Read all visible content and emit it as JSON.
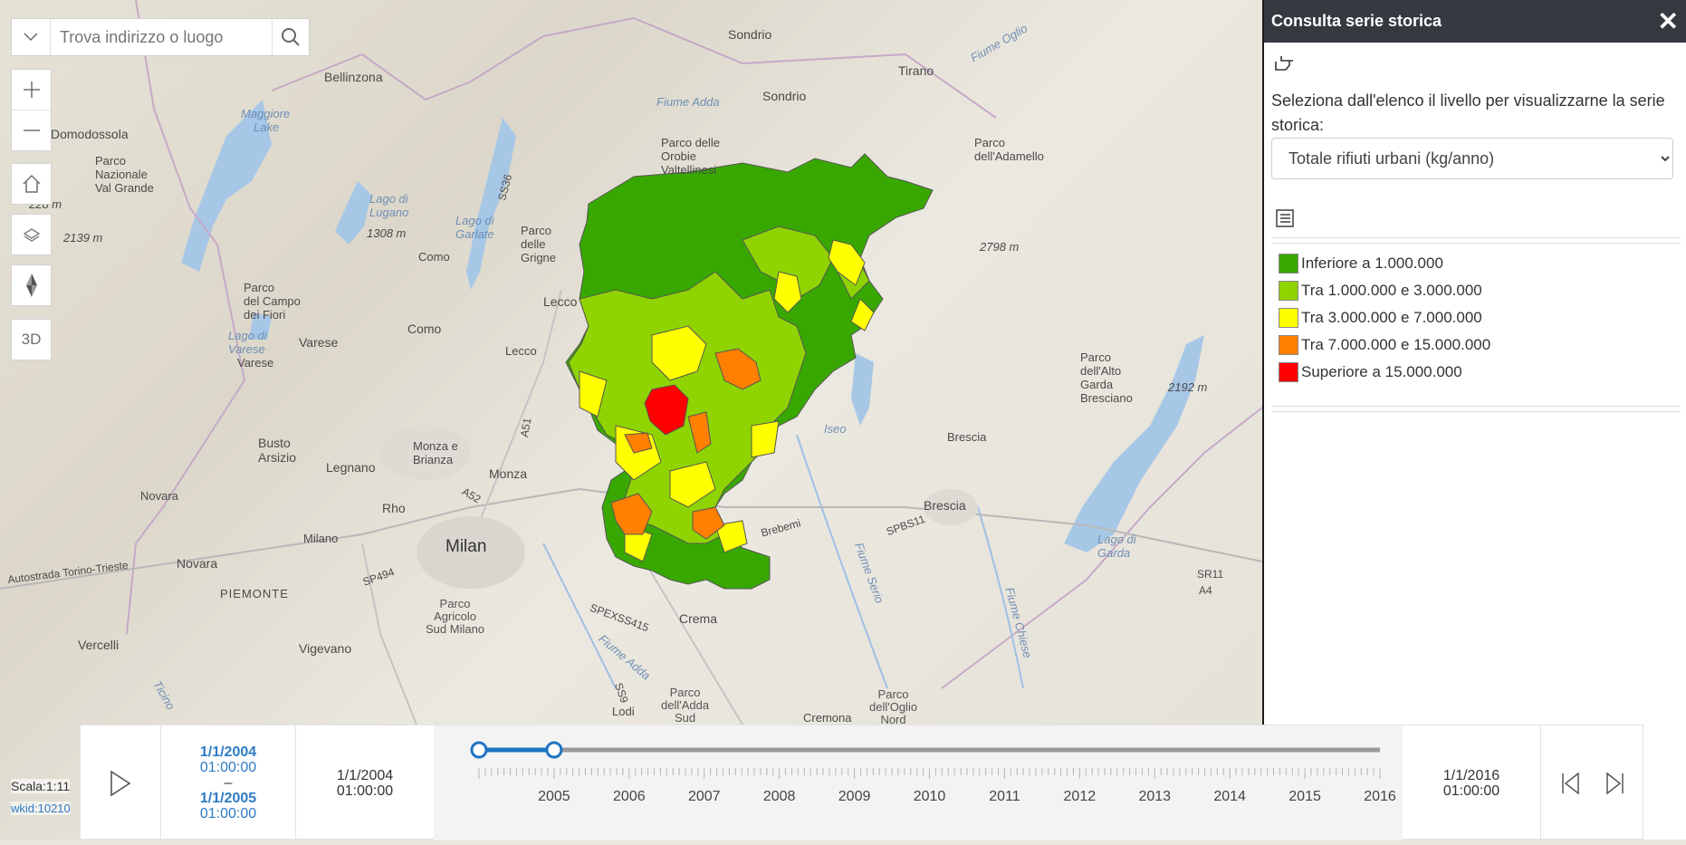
{
  "search": {
    "placeholder": "Trova indirizzo o luogo"
  },
  "controls": {
    "three_d_label": "3D"
  },
  "status": {
    "scale": "Scala:1:11",
    "wkid": "wkid:10210"
  },
  "map_labels": {
    "sondrio_top": "Sondrio",
    "bellinzona": "Bellinzona",
    "tirano": "Tirano",
    "sondrio": "Sondrio",
    "maggiore": "Maggiore",
    "lake": "Lake",
    "domodossola": "Domodossola",
    "parco_orobie": "Parco delle\nOrobie\nValtellinesi",
    "parco_adamello": "Parco\ndell'Adamello",
    "parco_val_grande": "Parco\nNazionale\nVal Grande",
    "lago_lugano": "Lago di\nLugano",
    "lago_garlate": "Lago di\nGarlate",
    "parco_grigne": "Parco\ndelle\nGrigne",
    "m2139": "2139 m",
    "m1308": "1308 m",
    "m2798": "2798 m",
    "como": "Como",
    "como2": "Como",
    "lecco": "Lecco",
    "lecco2": "Lecco",
    "parco_campo_fiori": "Parco\ndel Campo\ndei Fiori",
    "lago_varese": "Lago di\nVarese",
    "varese": "Varese",
    "varese2": "Varese",
    "parco_alto_garda": "Parco\ndell'Alto\nGarda\nBresciano",
    "m2192": "2192 m",
    "iseo": "Iseo",
    "busto_arsizio": "Busto\nArsizio",
    "legnano": "Legnano",
    "monza_brianza": "Monza e\nBrianza",
    "monza": "Monza",
    "brescia_small": "Brescia",
    "novara_small": "Novara",
    "rho": "Rho",
    "brescia": "Brescia",
    "milano_small": "Milano",
    "milan": "Milan",
    "novara": "Novara",
    "autostrada": "Autostrada Torino-Trieste",
    "piemonte": "PIEMONTE",
    "lago_garda": "Lago di\nGarda",
    "vercelli": "Vercelli",
    "vigevano": "Vigevano",
    "parco_sud_milano": "Parco\nAgricolo\nSud Milano",
    "crema": "Crema",
    "parco_adda_sud": "Parco\ndell'Adda\nSud",
    "parco_oglio_nord": "Parco\ndell'Oglio\nNord",
    "lodi": "Lodi",
    "cremona": "Cremona",
    "a51": "A51",
    "a52": "A52",
    "sp494": "SP494",
    "spexs415": "SPEXSS415",
    "spbs11": "SPBS11",
    "sr11": "SR11",
    "a4": "A4",
    "brebemi": "Brebemi",
    "fiume_adda": "Fiume Adda",
    "fiume_oglio": "Fiume Oglio",
    "fiume_serio": "Fiume Serio",
    "fiume_chiese": "Fiume Chiese",
    "ss36": "SS36",
    "ticino": "Ticino",
    "ss9": "SS9",
    "m228": "228 m",
    "fiume_adda_top": "Fiume Adda"
  },
  "panel": {
    "title": "Consulta serie storica",
    "description": "Seleziona dall'elenco il livello per visualizzarne la serie storica:",
    "selected_layer": "Totale rifiuti urbani (kg/anno)",
    "legend": [
      {
        "label": "Inferiore a 1.000.000",
        "color": "#38a800"
      },
      {
        "label": "Tra 1.000.000 e 3.000.000",
        "color": "#8fd400"
      },
      {
        "label": "Tra 3.000.000 e 7.000.000",
        "color": "#ffff00"
      },
      {
        "label": "Tra 7.000.000 e 15.000.000",
        "color": "#ff7f00"
      },
      {
        "label": "Superiore a 15.000.000",
        "color": "#ff0000"
      }
    ]
  },
  "time_slider": {
    "current_start_date": "1/1/2004",
    "current_start_time": "01:00:00",
    "dash": "–",
    "current_end_date": "1/1/2005",
    "current_end_time": "01:00:00",
    "min_date": "1/1/2004",
    "min_time": "01:00:00",
    "max_date": "1/1/2016",
    "max_time": "01:00:00",
    "years": [
      "2005",
      "2006",
      "2007",
      "2008",
      "2009",
      "2010",
      "2011",
      "2012",
      "2013",
      "2014",
      "2015",
      "2016"
    ],
    "range_start_fraction": 0.0,
    "range_end_fraction": 0.0833
  }
}
